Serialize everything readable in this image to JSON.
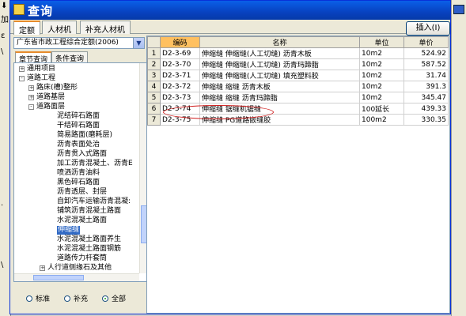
{
  "background": {
    "left_fragments": [
      "⬇",
      "加",
      "ε",
      "\\",
      "·",
      "\\"
    ]
  },
  "window": {
    "title": "查询"
  },
  "tabs": [
    {
      "label": "定额"
    },
    {
      "label": "人材机"
    },
    {
      "label": "补充人材机"
    }
  ],
  "toolbar": {
    "insert_label": "插入(I)"
  },
  "left_panel": {
    "library_select": "广东省市政工程综合定额(2006)",
    "subtabs": [
      {
        "label": "章节查询"
      },
      {
        "label": "条件查询"
      }
    ],
    "tree": [
      {
        "toggle": "+",
        "label": "通用项目"
      },
      {
        "toggle": "-",
        "label": "道路工程"
      },
      {
        "toggle": "+",
        "label": "路床(槽)整形"
      },
      {
        "toggle": "+",
        "label": "道路基层"
      },
      {
        "toggle": "-",
        "label": "道路面层"
      },
      {
        "toggle": "",
        "label": "泥结碎石路面"
      },
      {
        "toggle": "",
        "label": "干结碎石路面"
      },
      {
        "toggle": "",
        "label": "简易路面(磨耗层)"
      },
      {
        "toggle": "",
        "label": "沥青表面处治"
      },
      {
        "toggle": "",
        "label": "沥青贯入式路面"
      },
      {
        "toggle": "",
        "label": "加工沥青混凝土、沥青E"
      },
      {
        "toggle": "",
        "label": "喷洒沥青油料"
      },
      {
        "toggle": "",
        "label": "黑色碎石路面"
      },
      {
        "toggle": "",
        "label": "沥青透层、封层"
      },
      {
        "toggle": "",
        "label": "自卸汽车运输沥青混凝:"
      },
      {
        "toggle": "",
        "label": "铺筑沥青混凝土路面"
      },
      {
        "toggle": "",
        "label": "水泥混凝土路面"
      },
      {
        "toggle": "",
        "label": "伸缩缝"
      },
      {
        "toggle": "",
        "label": "水泥混凝土路面养生"
      },
      {
        "toggle": "",
        "label": "水泥混凝土路面钢筋"
      },
      {
        "toggle": "",
        "label": "道路传力杆套筒"
      },
      {
        "toggle": "+",
        "label": "人行道侧缘石及其他"
      }
    ],
    "selected_tree_item": "伸缩缝",
    "radios": [
      {
        "label": "标准",
        "checked": false
      },
      {
        "label": "补充",
        "checked": false
      },
      {
        "label": "全部",
        "checked": true
      }
    ]
  },
  "grid": {
    "columns": [
      "",
      "编码",
      "名称",
      "单位",
      "单价"
    ],
    "rows": [
      {
        "num": "1",
        "code": "D2-3-69",
        "name": "伸缩缝 伸缩缝(人工切缝) 沥青木板",
        "unit": "10m2",
        "price": "524.92"
      },
      {
        "num": "2",
        "code": "D2-3-70",
        "name": "伸缩缝 伸缩缝(人工切缝) 沥青玛蹄脂",
        "unit": "10m2",
        "price": "587.52"
      },
      {
        "num": "3",
        "code": "D2-3-71",
        "name": "伸缩缝 伸缩缝(人工切缝) 填充塑料胶",
        "unit": "10m2",
        "price": "31.74"
      },
      {
        "num": "4",
        "code": "D2-3-72",
        "name": "伸缩缝 缩缝 沥青木板",
        "unit": "10m2",
        "price": "391.3"
      },
      {
        "num": "5",
        "code": "D2-3-73",
        "name": "伸缩缝 缩缝 沥青玛蹄脂",
        "unit": "10m2",
        "price": "345.47"
      },
      {
        "num": "6",
        "code": "D2-3-74",
        "name": "伸缩缝 锯缝机锯缝",
        "unit": "100延长",
        "price": "439.33"
      },
      {
        "num": "7",
        "code": "D2-3-75",
        "name": "伸缩缝 PG道路嵌缝胶",
        "unit": "100m2",
        "price": "330.35"
      }
    ]
  },
  "colors": {
    "title_bar": "#0842c0",
    "tab_accent": "#e68b2c",
    "code_header": "#ffc060",
    "selection": "#316ac5",
    "annotation": "#d02020"
  }
}
